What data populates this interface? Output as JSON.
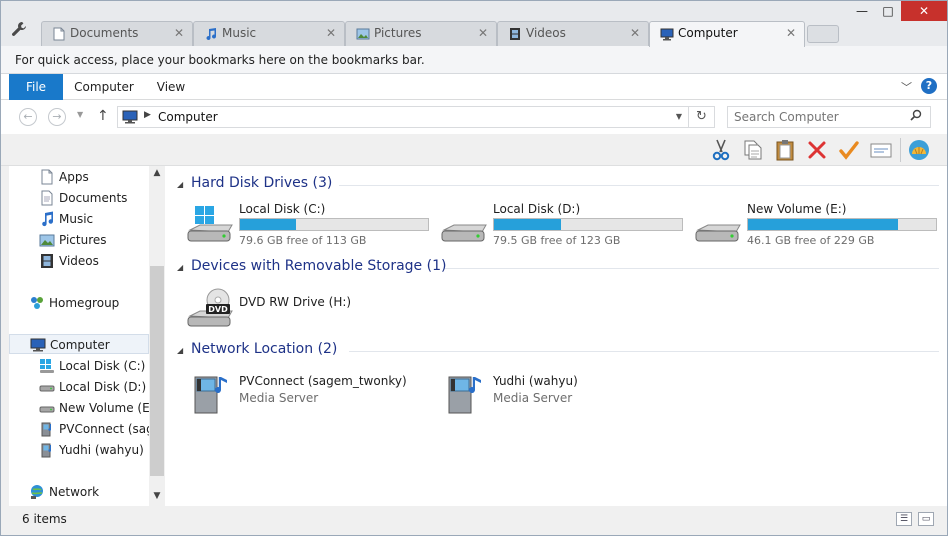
{
  "tabs": [
    {
      "label": "Documents",
      "icon": "document-icon",
      "active": false
    },
    {
      "label": "Music",
      "icon": "music-note-icon",
      "active": false
    },
    {
      "label": "Pictures",
      "icon": "picture-icon",
      "active": false
    },
    {
      "label": "Videos",
      "icon": "film-icon",
      "active": false
    },
    {
      "label": "Computer",
      "icon": "computer-icon",
      "active": true
    }
  ],
  "window_controls": {
    "minimize": "—",
    "maximize": "□",
    "close": "✕"
  },
  "bookmarks_bar": {
    "text": "For quick access, place your bookmarks here on the bookmarks bar."
  },
  "ribbon": {
    "tabs": [
      {
        "label": "File",
        "active": true
      },
      {
        "label": "Computer",
        "active": false
      },
      {
        "label": "View",
        "active": false
      }
    ],
    "help": "?"
  },
  "address": {
    "path": "Computer"
  },
  "search": {
    "placeholder": "Search Computer"
  },
  "toolbar": {
    "icons": [
      "cut-icon",
      "copy-icon",
      "paste-icon",
      "delete-icon",
      "checkmark-icon",
      "properties-icon",
      "shell-icon"
    ]
  },
  "sidebar": {
    "items": [
      {
        "label": "Apps",
        "icon": "document-icon",
        "selected": false
      },
      {
        "label": "Documents",
        "icon": "document-icon",
        "selected": false
      },
      {
        "label": "Music",
        "icon": "music-note-icon",
        "selected": false
      },
      {
        "label": "Pictures",
        "icon": "picture-icon",
        "selected": false
      },
      {
        "label": "Videos",
        "icon": "film-icon",
        "selected": false
      },
      {
        "label": "Homegroup",
        "icon": "homegroup-icon",
        "selected": false
      },
      {
        "label": "Computer",
        "icon": "computer-icon",
        "selected": true
      },
      {
        "label": "Local Disk (C:)",
        "icon": "windows-drive-icon",
        "selected": false
      },
      {
        "label": "Local Disk (D:)",
        "icon": "drive-icon",
        "selected": false
      },
      {
        "label": "New Volume (E:)",
        "icon": "drive-icon",
        "selected": false
      },
      {
        "label": "PVConnect (sage",
        "icon": "media-server-icon",
        "selected": false
      },
      {
        "label": "Yudhi (wahyu)",
        "icon": "media-server-icon",
        "selected": false
      },
      {
        "label": "Network",
        "icon": "network-icon",
        "selected": false
      }
    ]
  },
  "groups": {
    "hard_disk": {
      "title": "Hard Disk Drives (3)",
      "drives": [
        {
          "name": "Local Disk (C:)",
          "free": "79.6 GB free of 113 GB",
          "used_fraction": 0.296,
          "icon": "windows-drive-icon"
        },
        {
          "name": "Local Disk (D:)",
          "free": "79.5 GB free of 123 GB",
          "used_fraction": 0.354,
          "icon": "drive-icon"
        },
        {
          "name": "New Volume (E:)",
          "free": "46.1 GB free of 229 GB",
          "used_fraction": 0.799,
          "icon": "drive-icon"
        }
      ]
    },
    "removable": {
      "title": "Devices with Removable Storage (1)",
      "devices": [
        {
          "name": "DVD RW Drive (H:)",
          "icon": "dvd-drive-icon"
        }
      ]
    },
    "network": {
      "title": "Network Location (2)",
      "locations": [
        {
          "name": "PVConnect (sagem_twonky)",
          "type": "Media Server",
          "icon": "media-server-icon"
        },
        {
          "name": "Yudhi (wahyu)",
          "type": "Media Server",
          "icon": "media-server-icon"
        }
      ]
    }
  },
  "status": {
    "item_count": "6 items"
  },
  "colors": {
    "accent": "#1979ca",
    "bar_fill": "#26a0da",
    "group_title": "#1e3287",
    "close": "#c7312c"
  }
}
